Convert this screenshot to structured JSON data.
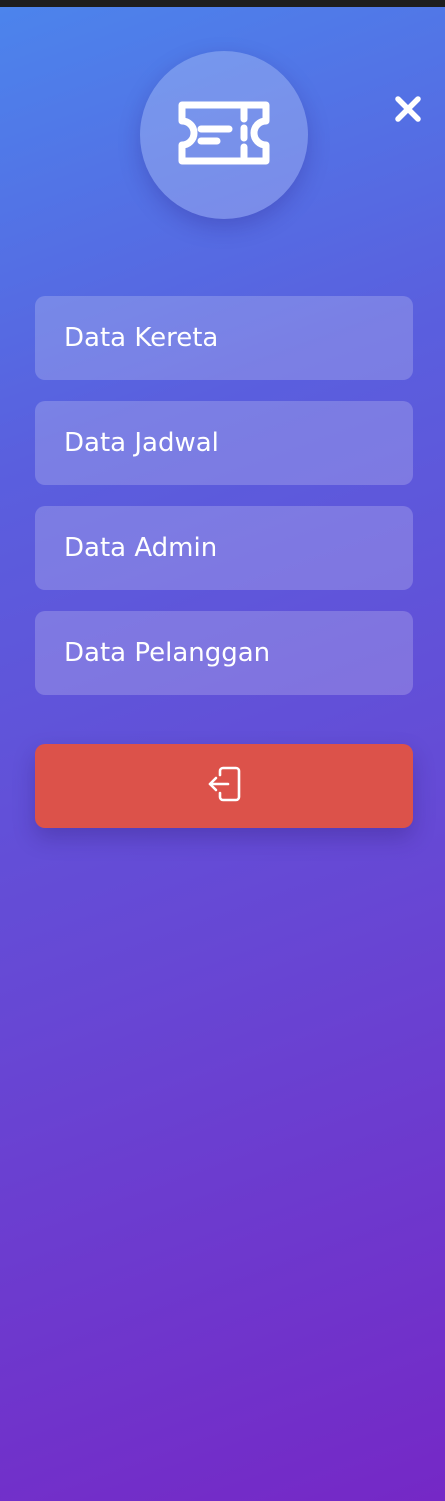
{
  "colors": {
    "gradient_start": "#4c84ec",
    "gradient_end": "#7528c6",
    "logout_button": "#dc524a",
    "text": "#ffffff"
  },
  "logo": {
    "icon": "ticket-icon"
  },
  "close": {
    "icon": "close-icon"
  },
  "menu": {
    "items": [
      {
        "label": "Data Kereta"
      },
      {
        "label": "Data Jadwal"
      },
      {
        "label": "Data Admin"
      },
      {
        "label": "Data Pelanggan"
      }
    ]
  },
  "logout": {
    "icon": "logout-icon"
  }
}
